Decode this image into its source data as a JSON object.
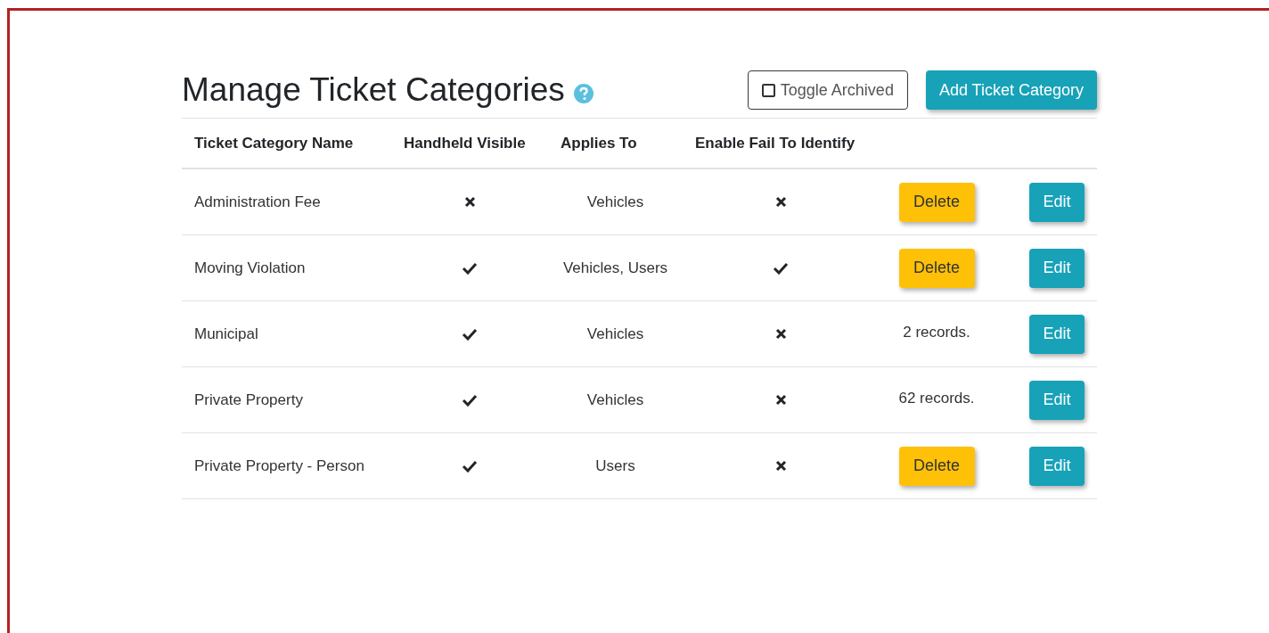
{
  "title": "Manage Ticket Categories",
  "toggle_archived": {
    "label": "Toggle Archived",
    "checked": false
  },
  "add_button": "Add Ticket Category",
  "table": {
    "columns": [
      "Ticket Category Name",
      "Handheld Visible",
      "Applies To",
      "Enable Fail To Identify"
    ],
    "rows": [
      {
        "name": "Administration Fee",
        "handheld_visible": false,
        "applies_to": "Vehicles",
        "enable_fail_to_identify": false,
        "action": {
          "kind": "delete",
          "label": "Delete"
        },
        "edit": "Edit"
      },
      {
        "name": "Moving Violation",
        "handheld_visible": true,
        "applies_to": "Vehicles, Users",
        "enable_fail_to_identify": true,
        "action": {
          "kind": "delete",
          "label": "Delete"
        },
        "edit": "Edit"
      },
      {
        "name": "Municipal",
        "handheld_visible": true,
        "applies_to": "Vehicles",
        "enable_fail_to_identify": false,
        "action": {
          "kind": "records",
          "label": "2 records."
        },
        "edit": "Edit"
      },
      {
        "name": "Private Property",
        "handheld_visible": true,
        "applies_to": "Vehicles",
        "enable_fail_to_identify": false,
        "action": {
          "kind": "records",
          "label": "62 records."
        },
        "edit": "Edit"
      },
      {
        "name": "Private Property - Person",
        "handheld_visible": true,
        "applies_to": "Users",
        "enable_fail_to_identify": false,
        "action": {
          "kind": "delete",
          "label": "Delete"
        },
        "edit": "Edit"
      }
    ]
  }
}
